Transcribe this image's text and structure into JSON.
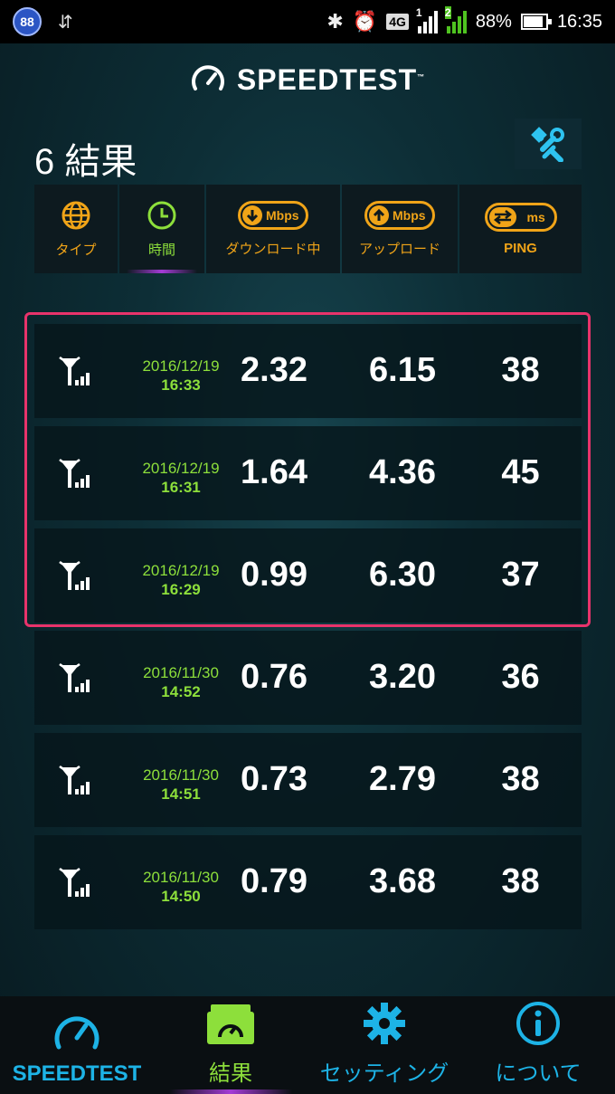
{
  "status_bar": {
    "badge": "88",
    "network": "4G",
    "sim1": "1",
    "sim2": "2",
    "battery": "88%",
    "battery_level": 0.88,
    "time": "16:35"
  },
  "header": {
    "brand": "SPEEDTEST",
    "trademark": "™",
    "results_title": "6 結果"
  },
  "sort_columns": [
    {
      "label": "タイプ",
      "icon": "globe-icon",
      "color": "#f0a418"
    },
    {
      "label": "時間",
      "icon": "clock-icon",
      "color": "#8ddf3b",
      "active": true
    },
    {
      "label": "ダウンロード中",
      "icon": "download-arrow-icon",
      "unit": "Mbps"
    },
    {
      "label": "アップロード",
      "icon": "upload-arrow-icon",
      "unit": "Mbps"
    },
    {
      "label": "PING",
      "icon": "ping-arrows-icon",
      "unit": "ms"
    }
  ],
  "results": [
    {
      "date": "2016/12/19",
      "time": "16:33",
      "download": "2.32",
      "upload": "6.15",
      "ping": "38",
      "highlighted": true
    },
    {
      "date": "2016/12/19",
      "time": "16:31",
      "download": "1.64",
      "upload": "4.36",
      "ping": "45",
      "highlighted": true
    },
    {
      "date": "2016/12/19",
      "time": "16:29",
      "download": "0.99",
      "upload": "6.30",
      "ping": "37",
      "highlighted": true
    },
    {
      "date": "2016/11/30",
      "time": "14:52",
      "download": "0.76",
      "upload": "3.20",
      "ping": "36",
      "highlighted": false
    },
    {
      "date": "2016/11/30",
      "time": "14:51",
      "download": "0.73",
      "upload": "2.79",
      "ping": "38",
      "highlighted": false
    },
    {
      "date": "2016/11/30",
      "time": "14:50",
      "download": "0.79",
      "upload": "3.68",
      "ping": "38",
      "highlighted": false
    }
  ],
  "bottom_nav": [
    {
      "label": "SPEEDTEST",
      "icon": "speedometer-icon"
    },
    {
      "label": "結果",
      "icon": "results-folder-icon",
      "active": true
    },
    {
      "label": "セッティング",
      "icon": "gear-icon"
    },
    {
      "label": "について",
      "icon": "info-icon"
    }
  ],
  "colors": {
    "accent_orange": "#f0a418",
    "accent_green": "#8ddf3b",
    "accent_blue": "#1db3e6",
    "highlight_border": "#e8336b"
  }
}
